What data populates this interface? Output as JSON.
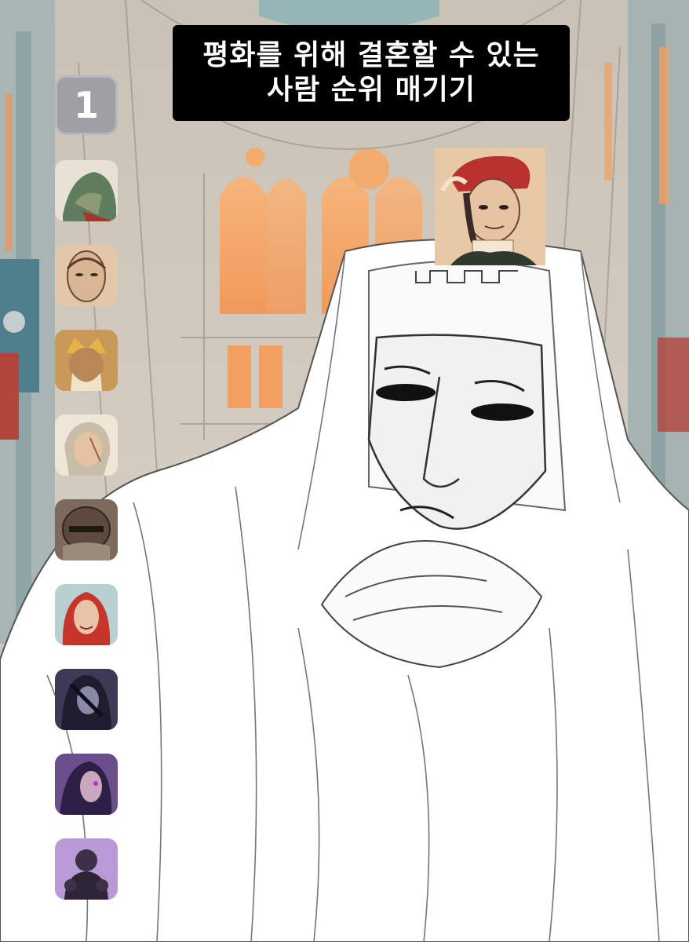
{
  "title": {
    "line1": "평화를 위해 결혼할 수 있는",
    "line2": "사람 순위 매기기"
  },
  "rank": {
    "label": "1"
  },
  "colors": {
    "banner": "#000000",
    "badge": "#9ea0a5",
    "window_glow": "#f5a768",
    "sky": "#b9d3d3"
  },
  "icons": {
    "candidates": [
      "armored-knight-portrait-icon",
      "bald-monk-portrait-icon",
      "golden-crowned-king-portrait-icon",
      "grey-haired-lord-portrait-icon",
      "helmeted-warrior-portrait-icon",
      "red-haired-woman-portrait-icon",
      "dark-haired-figure-portrait-icon",
      "purple-shadow-figure-portrait-icon",
      "violet-silhouette-portrait-icon"
    ],
    "current": "red-hat-noble-portrait-icon"
  }
}
